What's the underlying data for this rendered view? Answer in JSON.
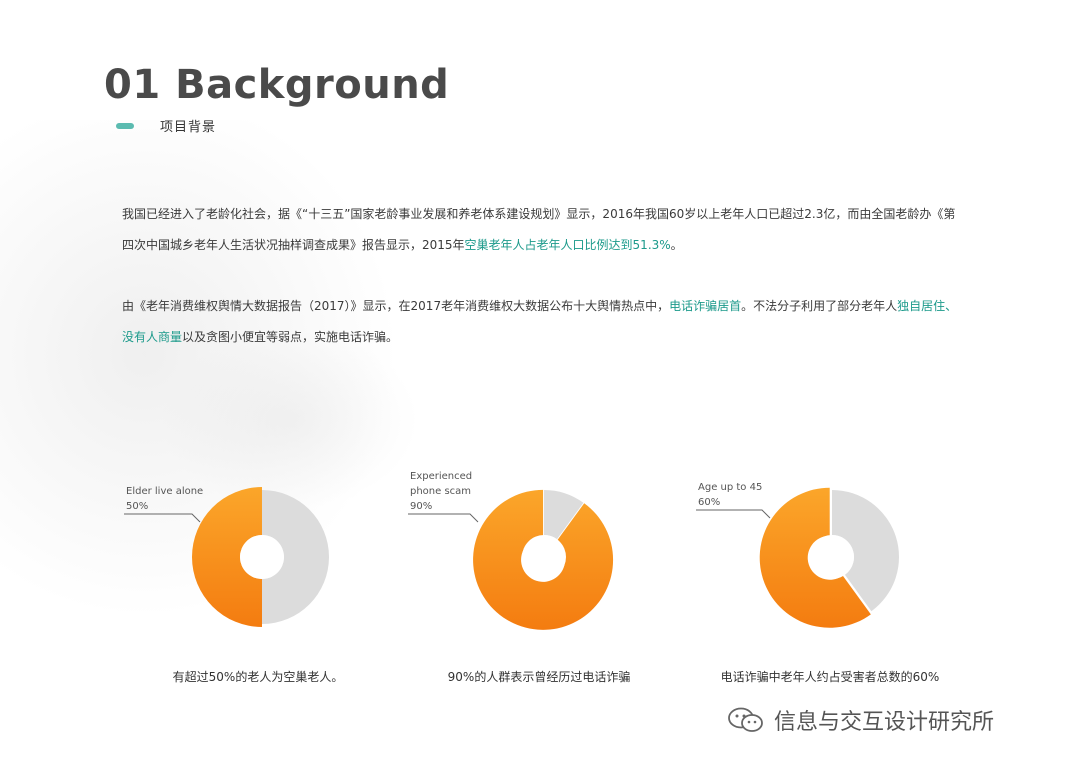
{
  "header": {
    "title": "01 Background",
    "subtitle": "项目背景",
    "accent_color": "#5bbbb0"
  },
  "paragraphs": {
    "p1": [
      {
        "text": "我国已经进入了老龄化社会，据《“十三五”国家老龄事业发展和养老体系建设规划》显示，2016年我国60岁以上老年人口已超过2.3亿，而由全国老龄办《第四次中国城乡老年人生活状况抽样调查成果》报告显示，2015年",
        "highlight": false
      },
      {
        "text": "空巢老年人占老年人口比例达到51.3%",
        "highlight": true
      },
      {
        "text": "。",
        "highlight": false
      }
    ],
    "p2": [
      {
        "text": "由《老年消费维权舆情大数据报告（2017）》显示，在2017老年消费维权大数据公布十大舆情热点中，",
        "highlight": false
      },
      {
        "text": "电话诈骗居首",
        "highlight": true
      },
      {
        "text": "。不法分子利用了部分老年人",
        "highlight": false
      },
      {
        "text": "独自居住、没有人商量",
        "highlight": true
      },
      {
        "text": "以及贪图小便宜等弱点，实施电话诈骗。",
        "highlight": false
      }
    ],
    "highlight_color": "#1c9a8b"
  },
  "chart_data": [
    {
      "type": "pie",
      "label_lines": [
        "Elder live alone",
        "50%"
      ],
      "value": 50,
      "remainder": 50,
      "caption": "有超过50%的老人为空巢老人。"
    },
    {
      "type": "pie",
      "label_lines": [
        "Experienced",
        "phone scam",
        "90%"
      ],
      "value": 90,
      "remainder": 10,
      "caption": "90%的人群表示曾经历过电话诈骗"
    },
    {
      "type": "pie",
      "label_lines": [
        "Age up to 45",
        "60%"
      ],
      "value": 60,
      "remainder": 40,
      "caption": "电话诈骗中老年人约占受害者总数的60%"
    }
  ],
  "colors": {
    "primary_slice": "#fb9a1a",
    "primary_slice_dark": "#f47c10",
    "remainder_slice": "#dcdcdc"
  },
  "watermark": {
    "text": "信息与交互设计研究所",
    "icon": "wechat-icon"
  }
}
